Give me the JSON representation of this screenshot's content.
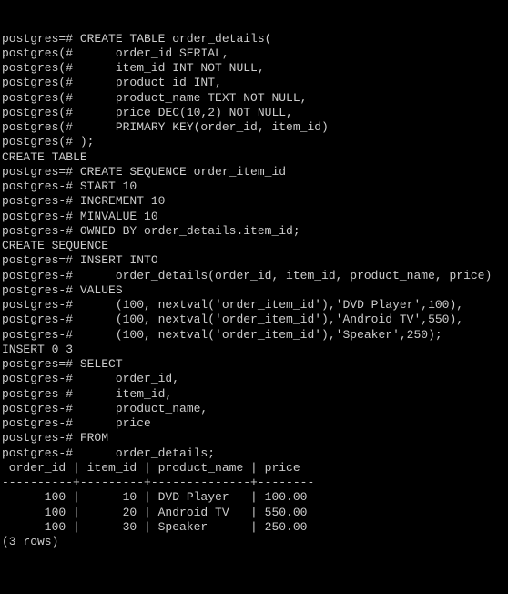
{
  "lines": [
    "postgres=# CREATE TABLE order_details(",
    "postgres(#      order_id SERIAL,",
    "postgres(#      item_id INT NOT NULL,",
    "postgres(#      product_id INT,",
    "postgres(#      product_name TEXT NOT NULL,",
    "postgres(#      price DEC(10,2) NOT NULL,",
    "postgres(#      PRIMARY KEY(order_id, item_id)",
    "postgres(# );",
    "CREATE TABLE",
    "postgres=# CREATE SEQUENCE order_item_id",
    "postgres-# START 10",
    "postgres-# INCREMENT 10",
    "postgres-# MINVALUE 10",
    "postgres-# OWNED BY order_details.item_id;",
    "CREATE SEQUENCE",
    "postgres=# INSERT INTO",
    "postgres-#      order_details(order_id, item_id, product_name, price)",
    "postgres-# VALUES",
    "postgres-#      (100, nextval('order_item_id'),'DVD Player',100),",
    "postgres-#      (100, nextval('order_item_id'),'Android TV',550),",
    "postgres-#      (100, nextval('order_item_id'),'Speaker',250);",
    "INSERT 0 3",
    "postgres=# SELECT",
    "postgres-#      order_id,",
    "postgres-#      item_id,",
    "postgres-#      product_name,",
    "postgres-#      price",
    "postgres-# FROM",
    "postgres-#      order_details;",
    " order_id | item_id | product_name | price",
    "----------+---------+--------------+--------",
    "      100 |      10 | DVD Player   | 100.00",
    "      100 |      20 | Android TV   | 550.00",
    "      100 |      30 | Speaker      | 250.00",
    "(3 rows)"
  ]
}
